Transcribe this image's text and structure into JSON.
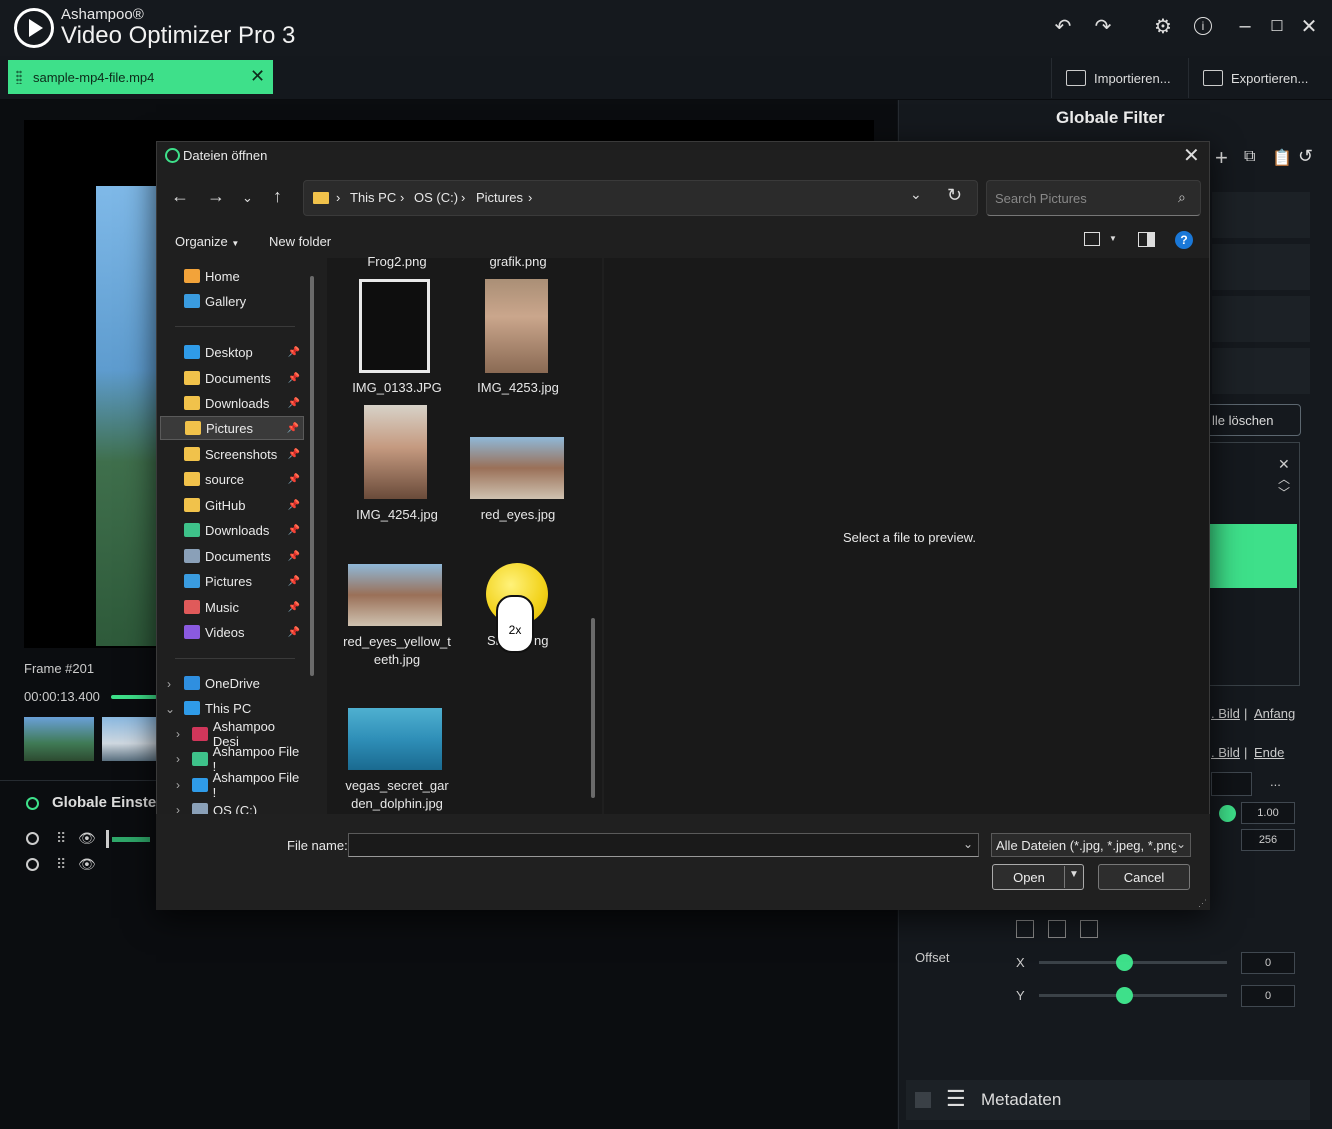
{
  "app": {
    "brand_small": "Ashampoo®",
    "brand_big": "Video Optimizer Pro 3"
  },
  "tab": {
    "label": "sample-mp4-file.mp4"
  },
  "header": {
    "import_label": "Importieren...",
    "export_label": "Exportieren..."
  },
  "left": {
    "frame_label": "Frame #201",
    "timecode": "00:00:13.400",
    "globale_label": "Globale Einstel"
  },
  "right": {
    "title": "Globale Filter",
    "alle_label": "lle löschen",
    "link1": ". Bild",
    "link1b": "Anfang",
    "link2": ". Bild",
    "link2b": "Ende",
    "val1": "1.00",
    "val2": "256",
    "offset_label": "Offset",
    "x_label": "X",
    "y_label": "Y",
    "x_val": "0",
    "y_val": "0",
    "metadaten": "Metadaten",
    "ellipsis": "...",
    "x_slider": 0.45,
    "y_slider": 0.45
  },
  "dialog": {
    "title": "Dateien öffnen",
    "crumbs": [
      "This PC",
      "OS (C:)",
      "Pictures"
    ],
    "search_placeholder": "Search Pictures",
    "organize": "Organize",
    "new_folder": "New folder",
    "sidebar": [
      {
        "label": "Home",
        "icon": "home-icon",
        "color": "#f2a33a"
      },
      {
        "label": "Gallery",
        "icon": "gallery-icon",
        "color": "#3a9ce0"
      },
      {
        "label": "Desktop",
        "icon": "desktop-icon",
        "color": "#2f9be8",
        "pin": true
      },
      {
        "label": "Documents",
        "icon": "folder-icon",
        "color": "#f1c24b",
        "pin": true
      },
      {
        "label": "Downloads",
        "icon": "folder-icon",
        "color": "#f1c24b",
        "pin": true
      },
      {
        "label": "Pictures",
        "icon": "folder-icon",
        "color": "#f1c24b",
        "pin": true,
        "selected": true
      },
      {
        "label": "Screenshots",
        "icon": "folder-icon",
        "color": "#f1c24b",
        "pin": true
      },
      {
        "label": "source",
        "icon": "folder-icon",
        "color": "#f1c24b",
        "pin": true
      },
      {
        "label": "GitHub",
        "icon": "folder-icon",
        "color": "#f1c24b",
        "pin": true
      },
      {
        "label": "Downloads",
        "icon": "download-icon",
        "color": "#3ec28a",
        "pin": true
      },
      {
        "label": "Documents",
        "icon": "document-icon",
        "color": "#8aa0b8",
        "pin": true
      },
      {
        "label": "Pictures",
        "icon": "pictures-icon",
        "color": "#3a9ce0",
        "pin": true
      },
      {
        "label": "Music",
        "icon": "music-icon",
        "color": "#e05a5a",
        "pin": true
      },
      {
        "label": "Videos",
        "icon": "videos-icon",
        "color": "#8a5ae0",
        "pin": true
      },
      {
        "label": "OneDrive",
        "icon": "cloud-icon",
        "color": "#2f8fe0"
      },
      {
        "label": "This PC",
        "icon": "pc-icon",
        "color": "#2f9be8"
      },
      {
        "label": "Ashampoo Desi",
        "icon": "ashampoo-icon",
        "color": "#d0365a"
      },
      {
        "label": "Ashampoo File !",
        "icon": "ashampoo-icon",
        "color": "#3ec28a"
      },
      {
        "label": "Ashampoo File !",
        "icon": "ashampoo-icon",
        "color": "#2f9be8"
      },
      {
        "label": "OS (C:)",
        "icon": "drive-icon",
        "color": "#8aa0b8"
      }
    ],
    "files": [
      {
        "name": "Frog2.png"
      },
      {
        "name": "grafik.png"
      },
      {
        "name": "IMG_0133.JPG"
      },
      {
        "name": "IMG_4253.jpg"
      },
      {
        "name": "IMG_4254.jpg"
      },
      {
        "name": "red_eyes.jpg"
      },
      {
        "name": "red_eyes_yellow_t",
        "name2": "eeth.jpg"
      },
      {
        "name": "Si",
        "name_end": "ng"
      },
      {
        "name": "vegas_secret_gar",
        "name2": "den_dolphin.jpg"
      }
    ],
    "preview_text": "Select a file to preview.",
    "file_name_label": "File name:",
    "file_type": "Alle Dateien (*.jpg, *.jpeg, *.png",
    "open_label": "Open",
    "cancel_label": "Cancel",
    "cursor_label": "2x"
  }
}
